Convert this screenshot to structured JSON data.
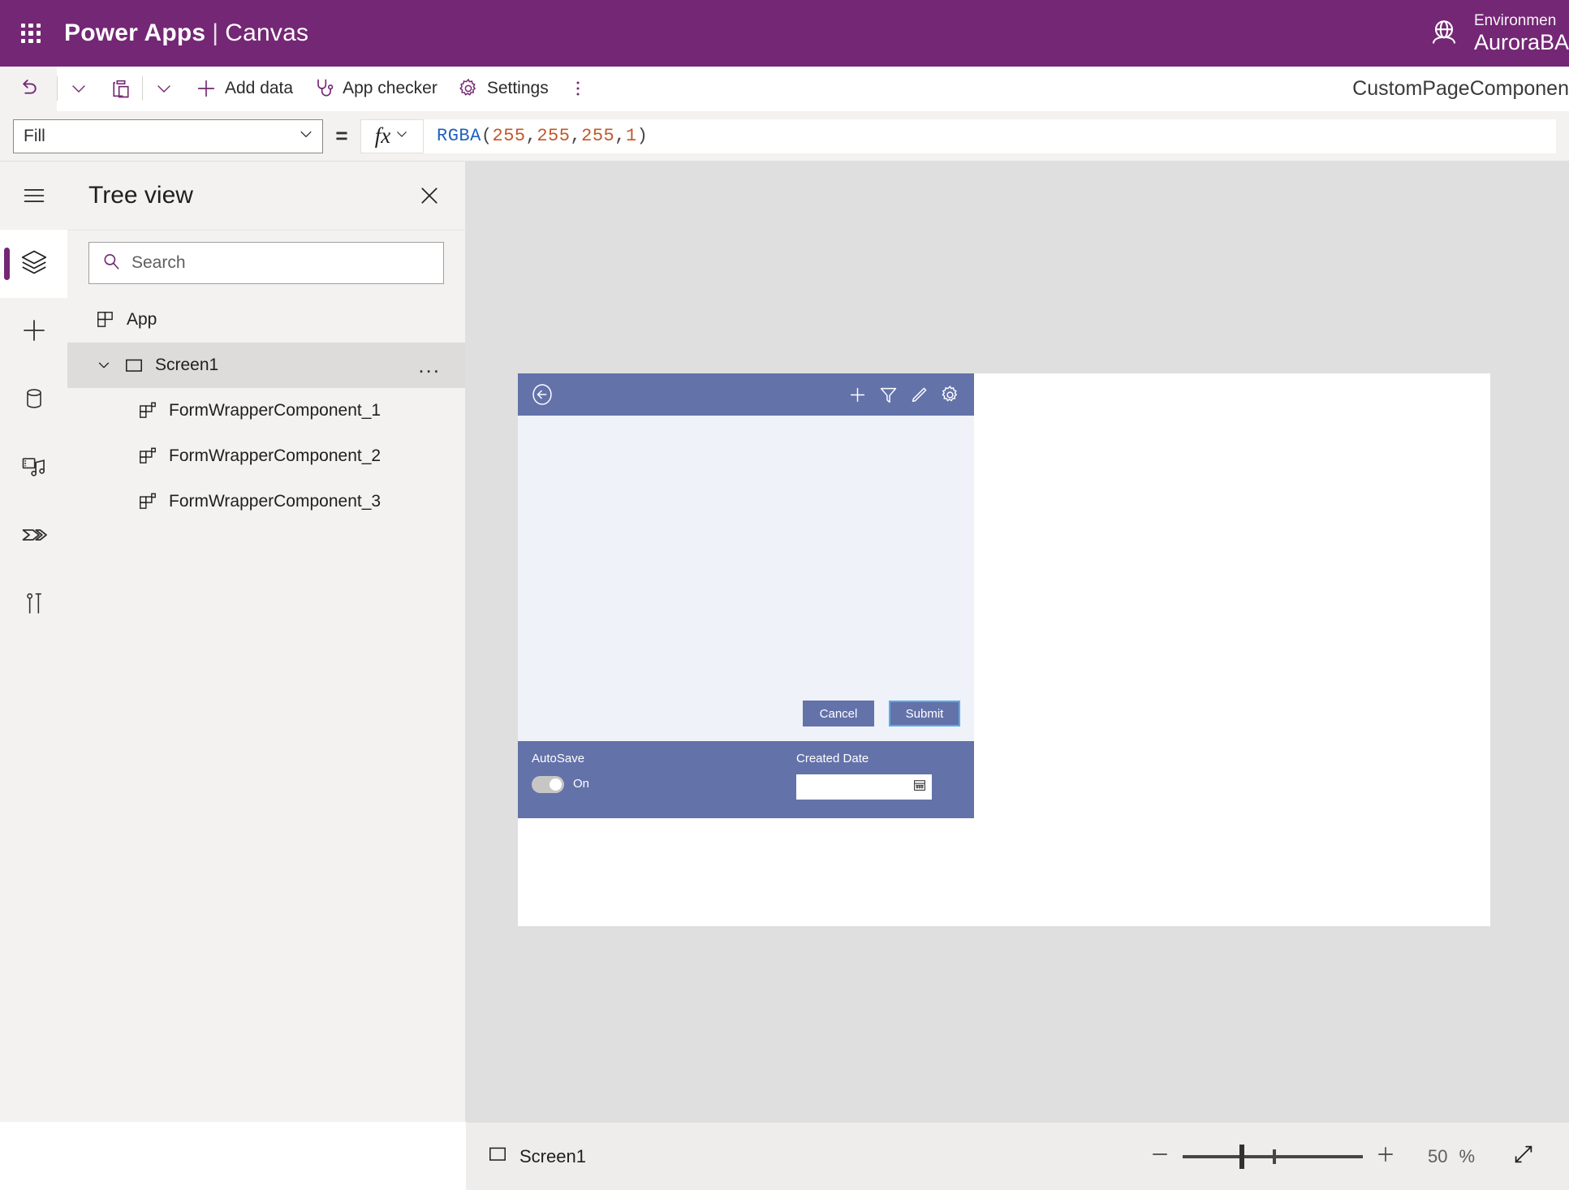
{
  "header": {
    "waffle_icon": "app-launcher-grid-icon",
    "brand": "Power Apps",
    "separator": "|",
    "brand_sub": "Canvas",
    "environment_label": "Environmen",
    "environment_name": "AuroraBA",
    "environment_icon": "globe-environment-icon"
  },
  "toolbar": {
    "undo_icon": "undo-arrow-icon",
    "undo_chevron_icon": "chevron-down-icon",
    "paste_icon": "clipboard-paste-icon",
    "paste_chevron_icon": "chevron-down-icon",
    "add_data_icon": "plus-icon",
    "add_data": "Add data",
    "app_checker_icon": "stethoscope-icon",
    "app_checker": "App checker",
    "settings_icon": "gear-icon",
    "settings": "Settings",
    "overflow_icon": "more-vertical-icon",
    "component_name": "CustomPageComponen"
  },
  "formula_bar": {
    "property": "Fill",
    "property_chevron_icon": "chevron-down-icon",
    "equals": "=",
    "fx_label": "fx",
    "fx_chevron_icon": "chevron-down-icon",
    "formula_tokens": [
      {
        "text": "RGBA",
        "kind": "fn"
      },
      {
        "text": "(",
        "kind": "pn"
      },
      {
        "text": "255",
        "kind": "num"
      },
      {
        "text": ", ",
        "kind": "pn"
      },
      {
        "text": "255",
        "kind": "num"
      },
      {
        "text": ", ",
        "kind": "pn"
      },
      {
        "text": "255",
        "kind": "num"
      },
      {
        "text": ", ",
        "kind": "pn"
      },
      {
        "text": "1",
        "kind": "num"
      },
      {
        "text": ")",
        "kind": "pn"
      }
    ],
    "formula_text": "RGBA(255, 255, 255, 1)"
  },
  "rail": {
    "items": [
      {
        "name": "hamburger-menu-icon",
        "icon": "hamburger",
        "selected": false
      },
      {
        "name": "tree-view-layers-icon",
        "icon": "layers",
        "selected": true
      },
      {
        "name": "insert-plus-icon",
        "icon": "plus",
        "selected": false
      },
      {
        "name": "data-cylinder-icon",
        "icon": "data",
        "selected": false
      },
      {
        "name": "media-icon",
        "icon": "media",
        "selected": false
      },
      {
        "name": "power-automate-icon",
        "icon": "flow",
        "selected": false
      },
      {
        "name": "advanced-tools-icon",
        "icon": "tools",
        "selected": false
      }
    ]
  },
  "tree_view": {
    "title": "Tree view",
    "close_icon": "close-icon",
    "search_icon": "search-icon",
    "search_placeholder": "Search",
    "search_value": "",
    "items": [
      {
        "label": "App",
        "icon": "app-grid-icon",
        "indent": 1,
        "selected": false,
        "expandable": false,
        "has_menu": false
      },
      {
        "label": "Screen1",
        "icon": "screen-rect-icon",
        "indent": 1,
        "selected": true,
        "expandable": true,
        "expand_icon": "chevron-down-icon",
        "has_menu": true,
        "menu_icon": "ellipsis-icon",
        "menu_label": "..."
      },
      {
        "label": "FormWrapperComponent_1",
        "icon": "component-icon",
        "indent": 2,
        "selected": false,
        "expandable": false,
        "has_menu": false
      },
      {
        "label": "FormWrapperComponent_2",
        "icon": "component-icon",
        "indent": 2,
        "selected": false,
        "expandable": false,
        "has_menu": false
      },
      {
        "label": "FormWrapperComponent_3",
        "icon": "component-icon",
        "indent": 2,
        "selected": false,
        "expandable": false,
        "has_menu": false
      }
    ]
  },
  "canvas_app": {
    "appbar": {
      "back_icon": "back-arrow-circle-icon",
      "actions": [
        {
          "name": "add-plus-icon"
        },
        {
          "name": "filter-funnel-icon"
        },
        {
          "name": "edit-pencil-icon"
        },
        {
          "name": "settings-gear-icon"
        }
      ]
    },
    "buttons": {
      "cancel": "Cancel",
      "submit": "Submit",
      "selected": "Submit"
    },
    "footer": {
      "autosave_label": "AutoSave",
      "autosave_state": "On",
      "created_date_label": "Created Date",
      "created_date_value": "",
      "calendar_icon": "calendar-icon"
    },
    "colors": {
      "appbar": "#6472AA",
      "body": "#EFF2F8",
      "accent": "#6472AA",
      "selection": "#5AABE8"
    }
  },
  "status_bar": {
    "screen_icon": "screen-rect-icon",
    "screen_label": "Screen1",
    "zoom_out_icon": "minus-icon",
    "zoom_in_icon": "plus-icon",
    "zoom_value": "50",
    "zoom_unit": "%",
    "fit_screen_icon": "fit-to-screen-diagonal-icon"
  },
  "theme": {
    "brand_purple": "#742774",
    "panel_gray": "#F3F2F1",
    "canvas_gray": "#DFDFDF"
  }
}
